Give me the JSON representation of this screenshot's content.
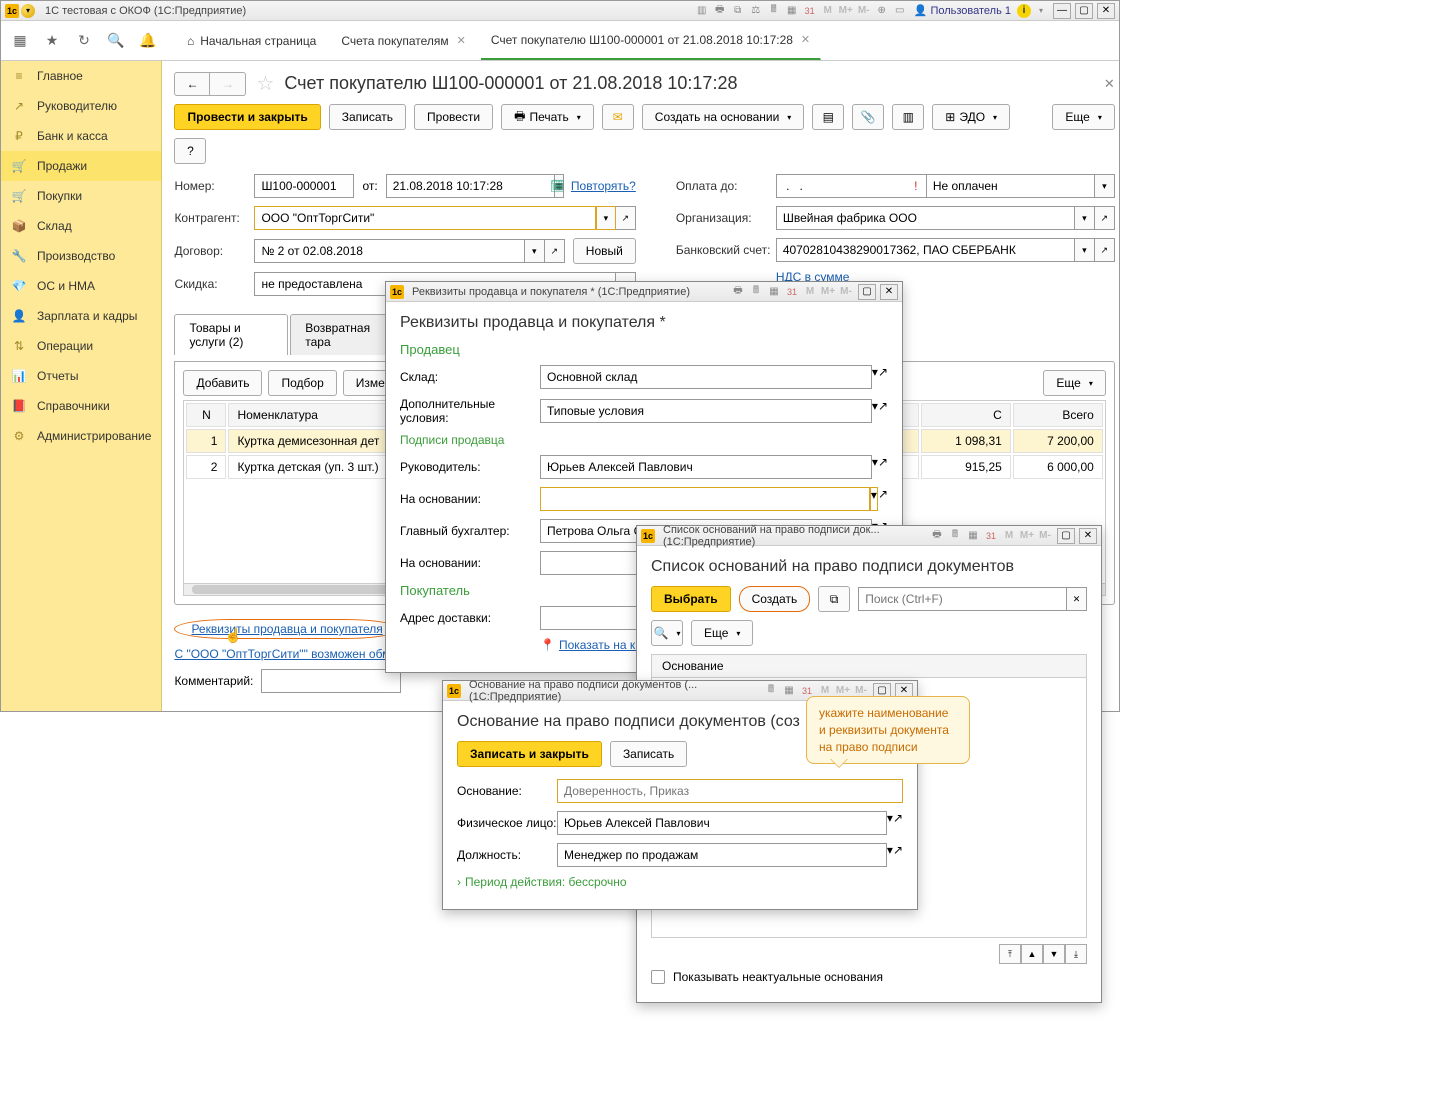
{
  "app": {
    "title": "1С тестовая с ОКОФ (1С:Предприятие)",
    "user": "Пользователь 1"
  },
  "mainTabs": {
    "home": "Начальная страница",
    "tab1": "Счета покупателям",
    "tab2": "Счет покупателю Ш100-000001 от 21.08.2018 10:17:28"
  },
  "sidebar": {
    "items": [
      {
        "icon": "≡",
        "label": "Главное"
      },
      {
        "icon": "↗",
        "label": "Руководителю"
      },
      {
        "icon": "₽",
        "label": "Банк и касса"
      },
      {
        "icon": "🛒",
        "label": "Продажи"
      },
      {
        "icon": "🛍",
        "label": "Покупки"
      },
      {
        "icon": "📦",
        "label": "Склад"
      },
      {
        "icon": "🏭",
        "label": "Производство"
      },
      {
        "icon": "💎",
        "label": "ОС и НМА"
      },
      {
        "icon": "👤",
        "label": "Зарплата и кадры"
      },
      {
        "icon": "⇅",
        "label": "Операции"
      },
      {
        "icon": "📊",
        "label": "Отчеты"
      },
      {
        "icon": "📕",
        "label": "Справочники"
      },
      {
        "icon": "⚙",
        "label": "Администрирование"
      }
    ]
  },
  "doc": {
    "title": "Счет покупателю Ш100-000001 от 21.08.2018 10:17:28",
    "saveAndClose": "Провести и закрыть",
    "save": "Записать",
    "post": "Провести",
    "print": "Печать",
    "createBased": "Создать на основании",
    "edo": "ЭДО",
    "more": "Еще",
    "help": "?",
    "numberLabel": "Номер:",
    "number": "Ш100-000001",
    "fromLabel": "от:",
    "date": "21.08.2018 10:17:28",
    "repeat": "Повторять?",
    "counterpartyLabel": "Контрагент:",
    "counterparty": "ООО \"ОптТоргСити\"",
    "contractLabel": "Договор:",
    "contract": "№ 2 от 02.08.2018",
    "new": "Новый",
    "discountLabel": "Скидка:",
    "discount": "не предоставлена",
    "payUntilLabel": "Оплата до:",
    "payUntil": " .   .",
    "notPaid": "Не оплачен",
    "orgLabel": "Организация:",
    "org": "Швейная фабрика ООО",
    "bankAccLabel": "Банковский счет:",
    "bankAcc": "40702810438290017362, ПАО СБЕРБАНК",
    "vatLink": "НДС в сумме",
    "tableTabs": {
      "tab1": "Товары и услуги (2)",
      "tab2": "Возвратная тара"
    },
    "tblButtons": {
      "add": "Добавить",
      "select": "Подбор",
      "change": "Изме"
    },
    "tblCols": {
      "n": "N",
      "nom": "Номенклатура",
      "c": "С",
      "total": "Всего"
    },
    "rows": [
      {
        "n": "1",
        "nom": "Куртка демисезонная дет",
        "c": "1 098,31",
        "total": "7 200,00"
      },
      {
        "n": "2",
        "nom": "Куртка детская (уп. 3 шт.)",
        "c": "915,25",
        "total": "6 000,00"
      }
    ],
    "footerLink": "Реквизиты продавца и покупателя",
    "exchangeLink": "С \"ООО \"ОптТоргСити\"\" возможен обме",
    "commentLabel": "Комментарий:"
  },
  "popup1": {
    "winTitle": "Реквизиты продавца и покупателя *  (1С:Предприятие)",
    "title": "Реквизиты продавца и покупателя *",
    "seller": "Продавец",
    "warehouseLabel": "Склад:",
    "warehouse": "Основной склад",
    "condLabel": "Дополнительные условия:",
    "cond": "Типовые условия",
    "sigTitle": "Подписи продавца",
    "managerLabel": "Руководитель:",
    "manager": "Юрьев Алексей Павлович",
    "basisLabel": "На основании:",
    "basis": "",
    "accountantLabel": "Главный бухгалтер:",
    "accountant": "Петрова Ольга Степановна",
    "basis2Label": "На основании:",
    "buyer": "Покупатель",
    "addrLabel": "Адрес доставки:",
    "showMapLink": "Показать на карт"
  },
  "popup2": {
    "winTitle": "Список оснований на право подписи док...  (1С:Предприятие)",
    "title": "Список оснований на право подписи документов",
    "select": "Выбрать",
    "create": "Создать",
    "searchPh": "Поиск (Ctrl+F)",
    "more": "Еще",
    "colBasis": "Основание",
    "showIrrelevant": "Показывать неактуальные основания"
  },
  "popup3": {
    "winTitle": "Основание на право подписи документов (... (1С:Предприятие)",
    "title": "Основание на право подписи документов (соз",
    "saveClose": "Записать и закрыть",
    "save": "Записать",
    "basisLabel": "Основание:",
    "basisPh": "Доверенность, Приказ",
    "personLabel": "Физическое лицо:",
    "person": "Юрьев Алексей Павлович",
    "positionLabel": "Должность:",
    "position": "Менеджер по продажам",
    "periodLink": "Период действия: бессрочно"
  },
  "tooltip": {
    "line1": "укажите наименование",
    "line2": "и реквизиты документа",
    "line3": "на право подписи"
  }
}
